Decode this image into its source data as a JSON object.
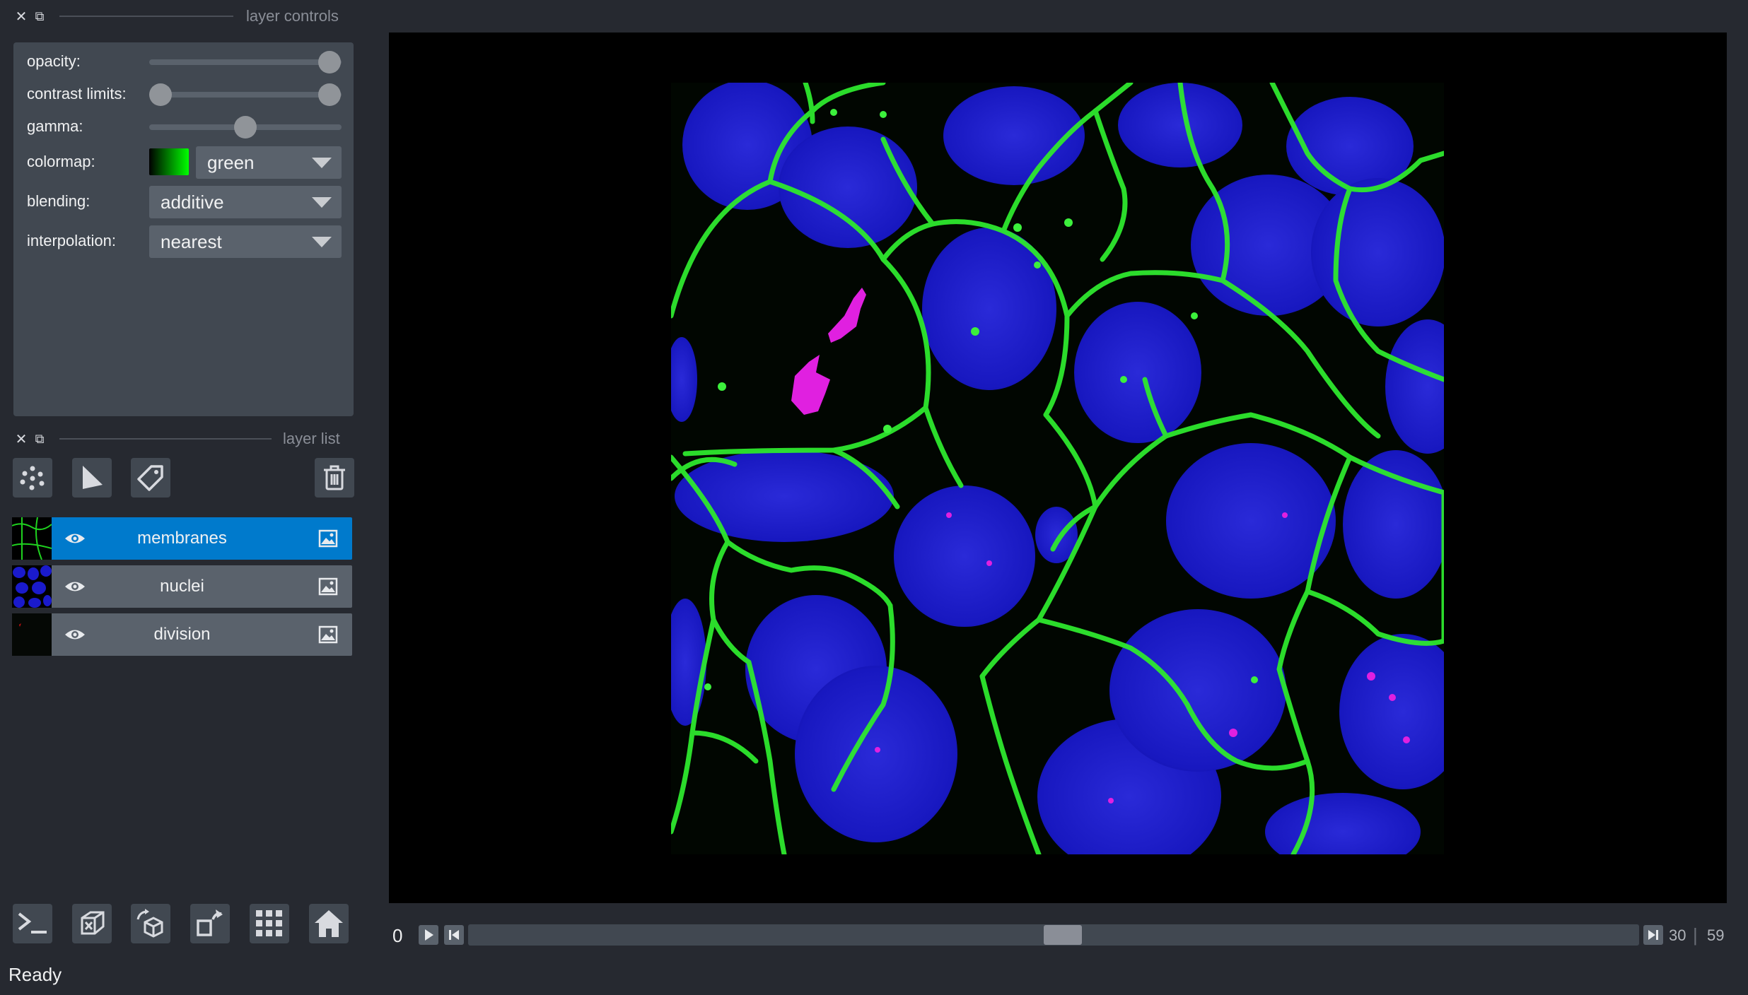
{
  "docks": {
    "controls_title": "layer controls",
    "list_title": "layer list",
    "close_glyph": "✕",
    "float_glyph": "⧉"
  },
  "layer_controls": {
    "opacity_label": "opacity:",
    "opacity_value": 1.0,
    "contrast_label": "contrast limits:",
    "contrast_value": [
      0.0,
      1.0
    ],
    "gamma_label": "gamma:",
    "gamma_value": 0.5,
    "colormap_label": "colormap:",
    "colormap_value": "green",
    "blending_label": "blending:",
    "blending_value": "additive",
    "interpolation_label": "interpolation:",
    "interpolation_value": "nearest"
  },
  "layers": [
    {
      "name": "membranes",
      "selected": true,
      "visible": true
    },
    {
      "name": "nuclei",
      "selected": false,
      "visible": true
    },
    {
      "name": "division",
      "selected": false,
      "visible": true
    }
  ],
  "dims": {
    "axis_label": "0",
    "current": "30",
    "max": "59",
    "separator": "|"
  },
  "status": {
    "text": "Ready"
  },
  "colors": {
    "accent": "#007acc",
    "background": "#262930",
    "panel": "#414851"
  }
}
